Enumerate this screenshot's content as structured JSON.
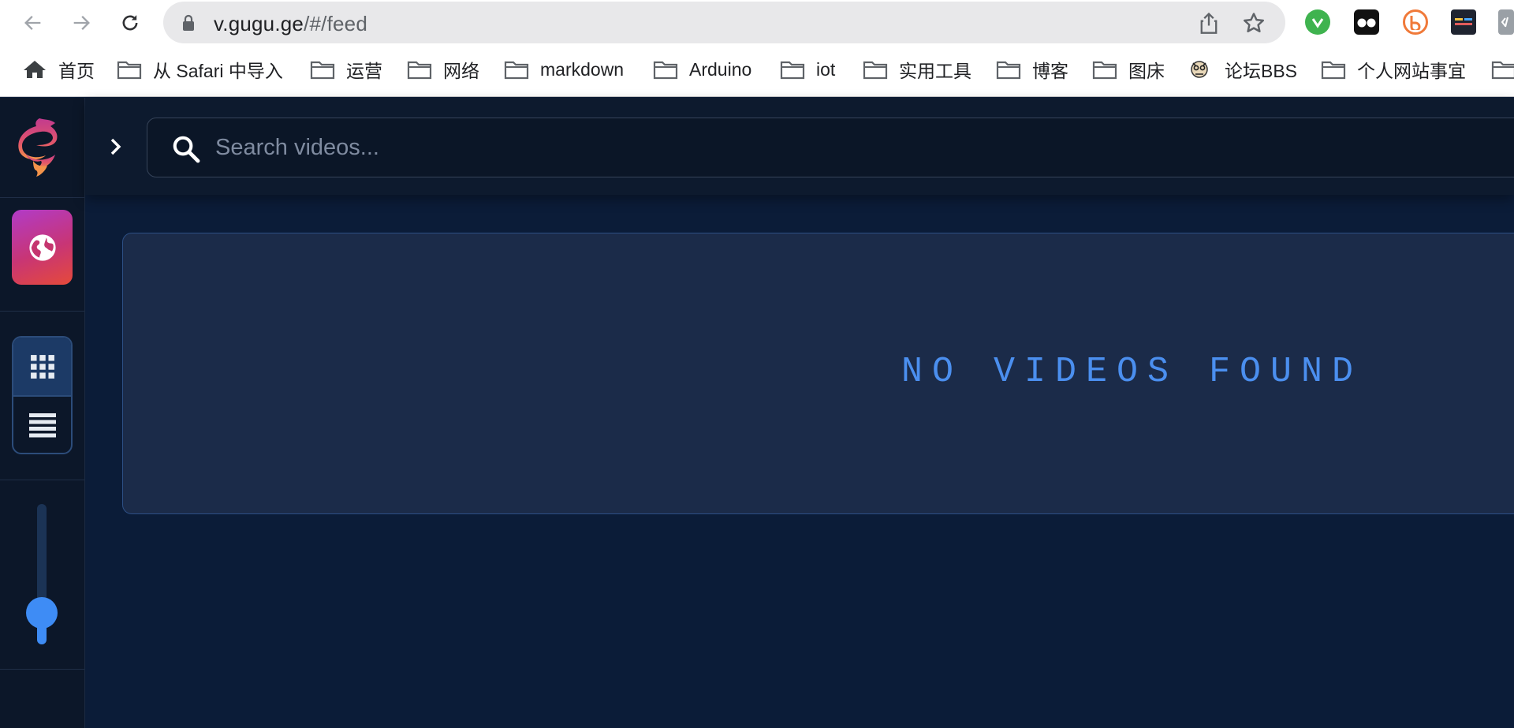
{
  "browser": {
    "url_host": "v.gugu.ge",
    "url_path": "/#/feed",
    "icons": {
      "back": "arrow-left-icon",
      "forward": "arrow-right-icon",
      "reload": "reload-icon",
      "lock": "lock-icon",
      "share": "share-icon",
      "bookmark": "star-icon"
    },
    "extensions": [
      {
        "name": "green-ext-icon",
        "color": "#3fb34f"
      },
      {
        "name": "glasses-ext-icon",
        "color": "#111111"
      },
      {
        "name": "orange-b-ext-icon",
        "color": "#f07a3a"
      },
      {
        "name": "dark-terminal-ext-icon",
        "color": "#1f2430"
      },
      {
        "name": "code-ext-icon",
        "color": "#9aa0a6"
      }
    ]
  },
  "bookmarks": [
    {
      "label": "首页",
      "icon": "home-icon"
    },
    {
      "label": "从 Safari 中导入",
      "icon": "folder-icon"
    },
    {
      "label": "运营",
      "icon": "folder-icon"
    },
    {
      "label": "网络",
      "icon": "folder-icon"
    },
    {
      "label": "markdown",
      "icon": "folder-icon"
    },
    {
      "label": "Arduino",
      "icon": "folder-icon"
    },
    {
      "label": "iot",
      "icon": "folder-icon"
    },
    {
      "label": "实用工具",
      "icon": "folder-icon"
    },
    {
      "label": "博客",
      "icon": "folder-icon"
    },
    {
      "label": "图床",
      "icon": "folder-icon"
    },
    {
      "label": "论坛BBS",
      "icon": "avatar-favicon-icon"
    },
    {
      "label": "个人网站事宜",
      "icon": "folder-icon"
    }
  ],
  "app": {
    "sidebar": {
      "logo": "dragon-logo-icon",
      "globe_button_icon": "globe-icon",
      "view_modes": [
        {
          "name": "grid-view",
          "icon": "grid-icon",
          "active": true
        },
        {
          "name": "list-view",
          "icon": "list-icon",
          "active": false
        }
      ],
      "size_slider_value": 0.25
    },
    "search": {
      "placeholder": "Search videos...",
      "value": ""
    },
    "empty_message": "NO VIDEOS FOUND",
    "colors": {
      "background": "#0b1c38",
      "accent": "#3e8cf5",
      "empty_text": "#4b8fef"
    }
  }
}
